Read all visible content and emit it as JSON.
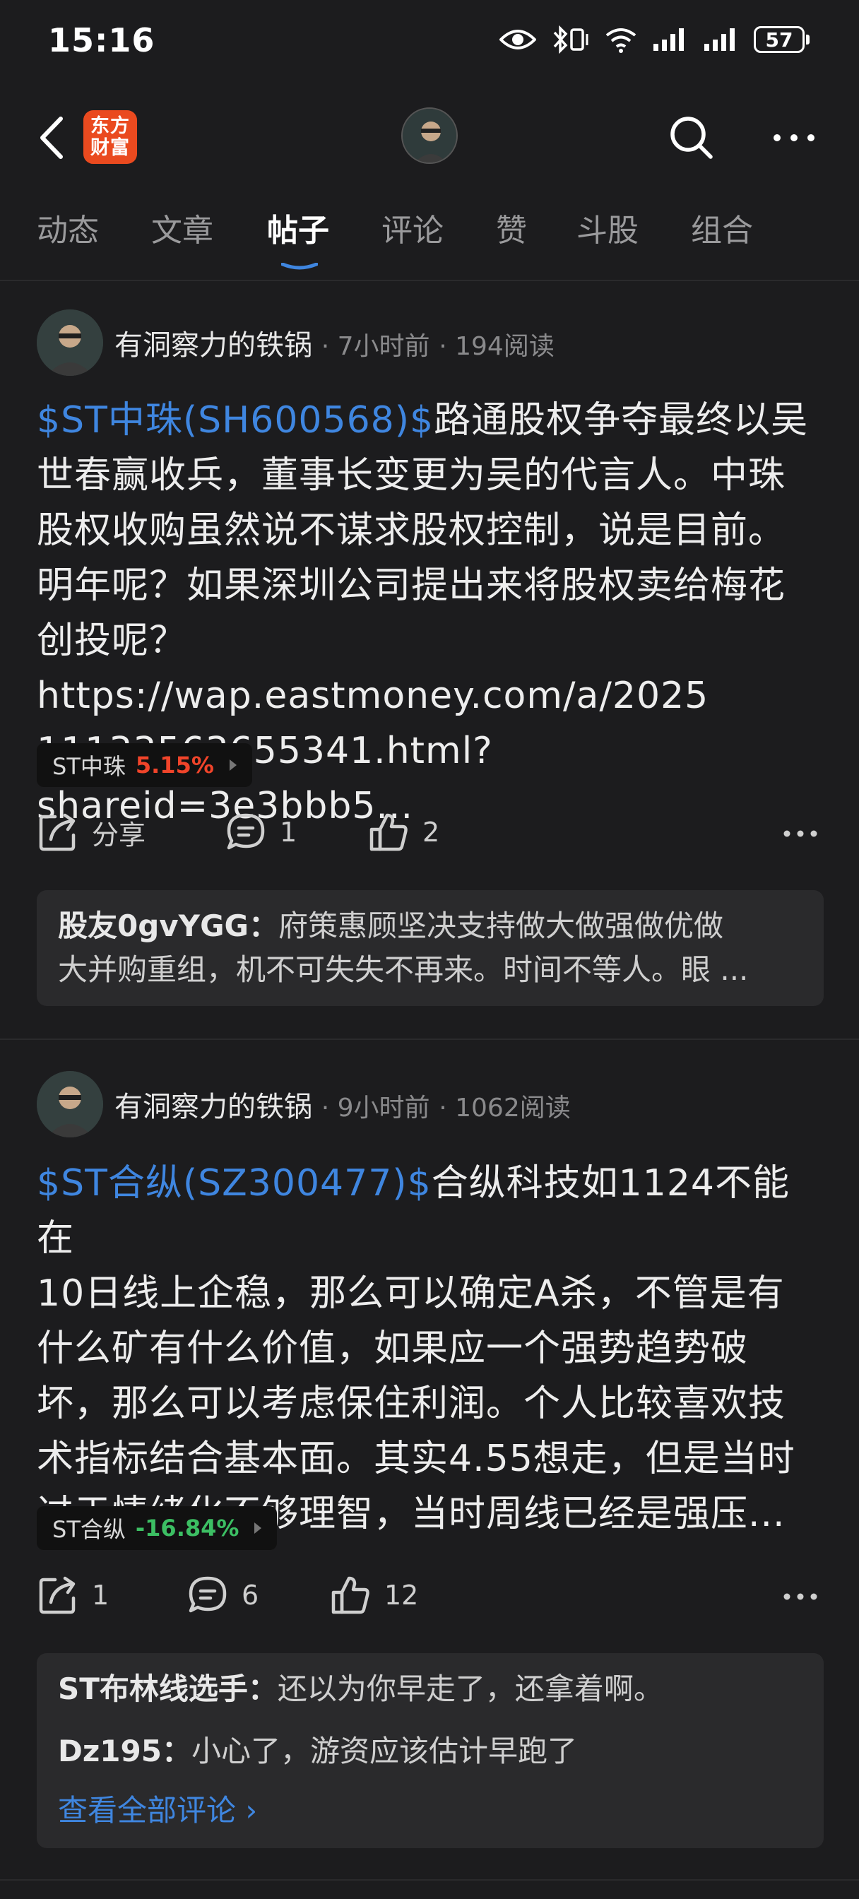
{
  "status_bar": {
    "time": "15:16",
    "battery": "57",
    "icons": [
      "eye-icon",
      "bluetooth-icon",
      "vibrate-icon",
      "wifi-icon",
      "signal-icon",
      "signal-icon",
      "battery-icon"
    ]
  },
  "navbar": {
    "logo_line1": "东方",
    "logo_line2": "财富",
    "logo_color": "#ea4a1f"
  },
  "tabs": [
    {
      "label": "动态"
    },
    {
      "label": "文章"
    },
    {
      "label": "帖子"
    },
    {
      "label": "评论"
    },
    {
      "label": "赞"
    },
    {
      "label": "斗股"
    },
    {
      "label": "组合"
    }
  ],
  "active_tab": "帖子",
  "accent_color": "#3f86e0",
  "posts": [
    {
      "author": "有洞察力的铁锅",
      "time": "7小时前",
      "reads": "194阅读",
      "stock_link": "$ST中珠(SH600568)$",
      "lines": [
        "路通股权争夺最终以吴",
        "世春赢收兵，董事长变更为吴的代言人。中珠",
        "股权收购虽然说不谋求股权控制，说是目前。",
        "明年呢？如果深圳公司提出来将股权卖给梅花",
        "创投呢？https://wap.eastmoney.com/a/2025",
        "11133563655341.html?shareid=3e3bbb5..."
      ],
      "chip_name": "ST中珠",
      "chip_change": "5.15%",
      "share": "分享",
      "comments": "1",
      "likes": "2",
      "comment_preview": [
        {
          "user": "股友0gvYGG：",
          "text": "府策惠顾坚决支持做大做强做优做"
        },
        {
          "user": "",
          "text": "大并购重组，机不可失失不再来。时间不等人。眼 ..."
        }
      ]
    },
    {
      "author": "有洞察力的铁锅",
      "time": "9小时前",
      "reads": "1062阅读",
      "stock_link": "$ST合纵(SZ300477)$",
      "lines": [
        "合纵科技如1124不能在",
        "10日线上企稳，那么可以确定A杀，不管是有",
        "什么矿有什么价值，如果应一个强势趋势破",
        "坏，那么可以考虑保住利润。个人比较喜欢技",
        "术指标结合基本面。其实4.55想走，但是当时",
        "过于情绪化不够理智，当时周线已经是强压..."
      ],
      "chip_name": "ST合纵",
      "chip_change": "-16.84%",
      "share": "1",
      "comments": "6",
      "likes": "12",
      "comment_preview": [
        {
          "user": "ST布林线选手：",
          "text": "还以为你早走了，还拿着啊。"
        },
        {
          "user": "Dz195：",
          "text": "小心了，游资应该估计早跑了"
        }
      ],
      "view_all": "查看全部评论 ›"
    }
  ]
}
